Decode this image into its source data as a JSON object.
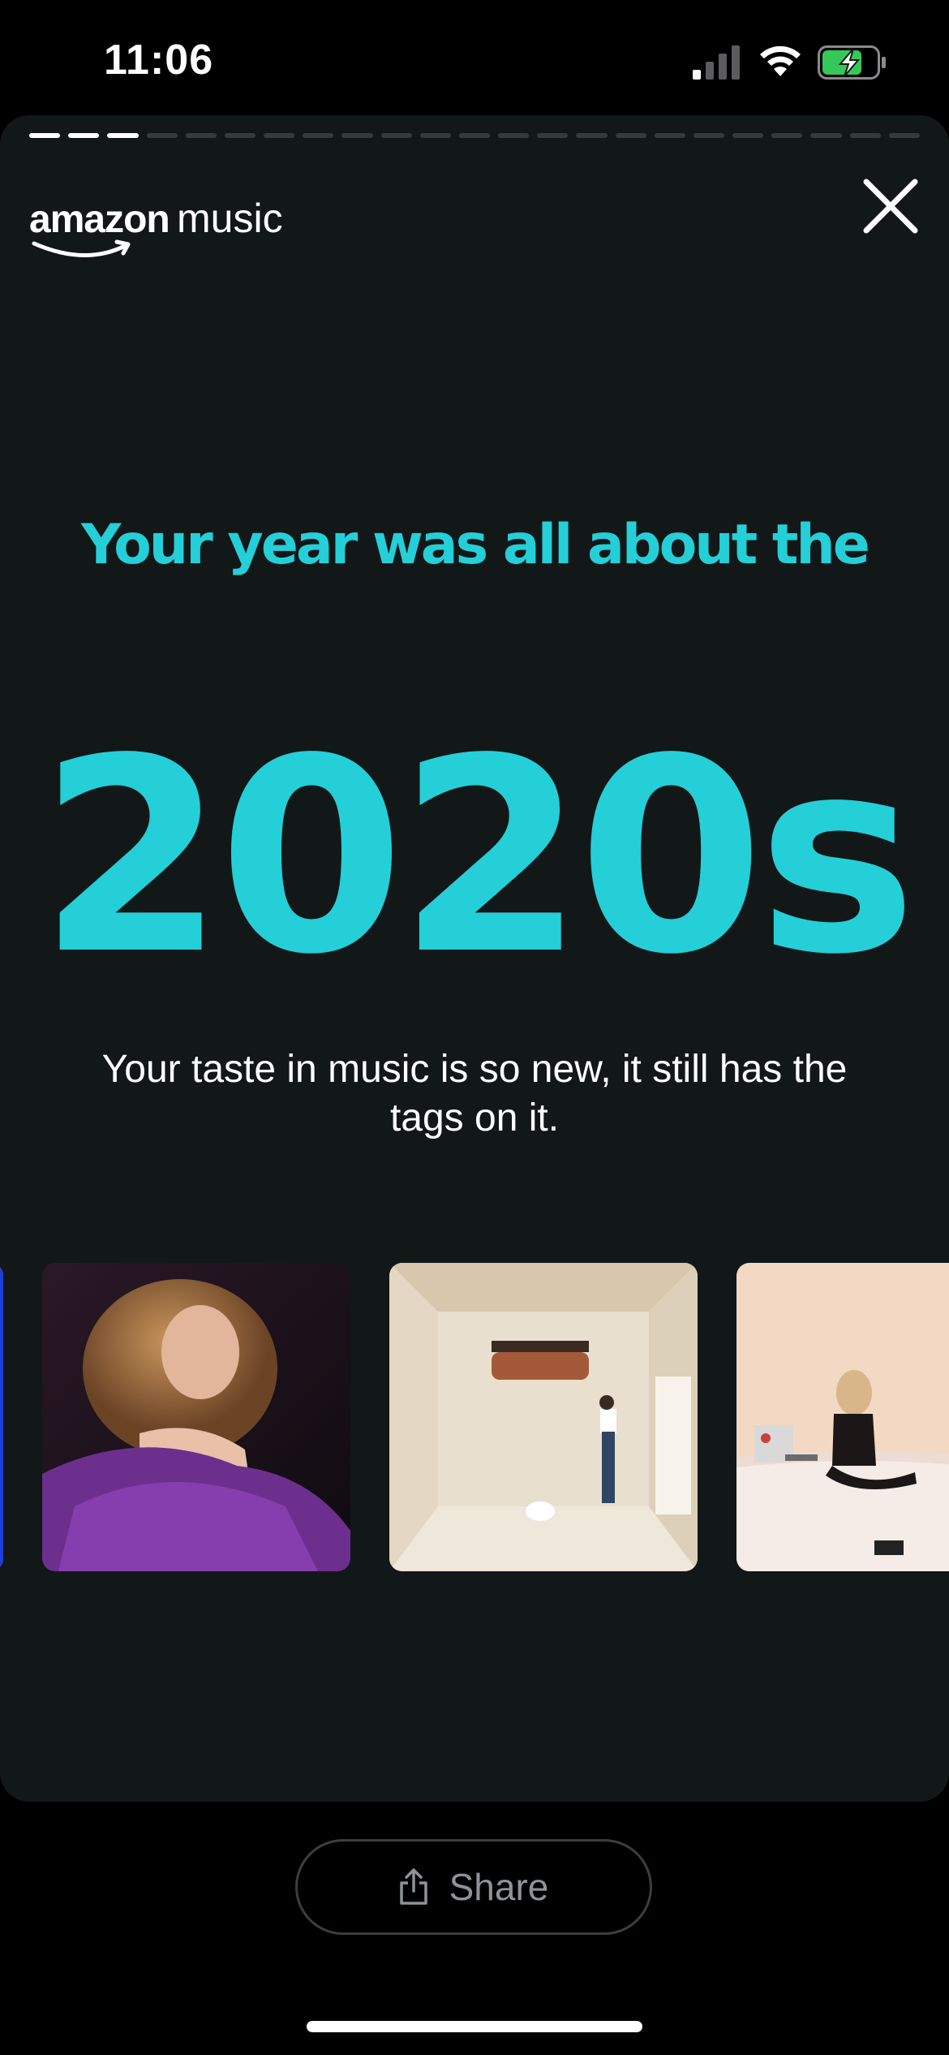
{
  "status_bar": {
    "time": "11:06",
    "signal_icon": "cellular-signal-icon",
    "wifi_icon": "wifi-icon",
    "battery_icon": "battery-charging-icon"
  },
  "story": {
    "progress": {
      "total_segments": 23,
      "completed_segments": 3
    },
    "brand": {
      "word1": "amazon",
      "word2": "music"
    },
    "close_icon": "close-icon",
    "headline": "Your year was all about the",
    "decade": "2020s",
    "tagline": "Your taste in music is so new, it still has the tags on it.",
    "albums": [
      {
        "icon": "album-cover-image"
      },
      {
        "icon": "album-cover-image"
      },
      {
        "icon": "album-cover-image"
      },
      {
        "icon": "album-cover-image"
      }
    ]
  },
  "footer": {
    "share_label": "Share",
    "share_icon": "share-icon"
  },
  "colors": {
    "accent": "#24cfd8",
    "card_background": "#121718",
    "background": "#000000",
    "battery_fill": "#35c759"
  }
}
